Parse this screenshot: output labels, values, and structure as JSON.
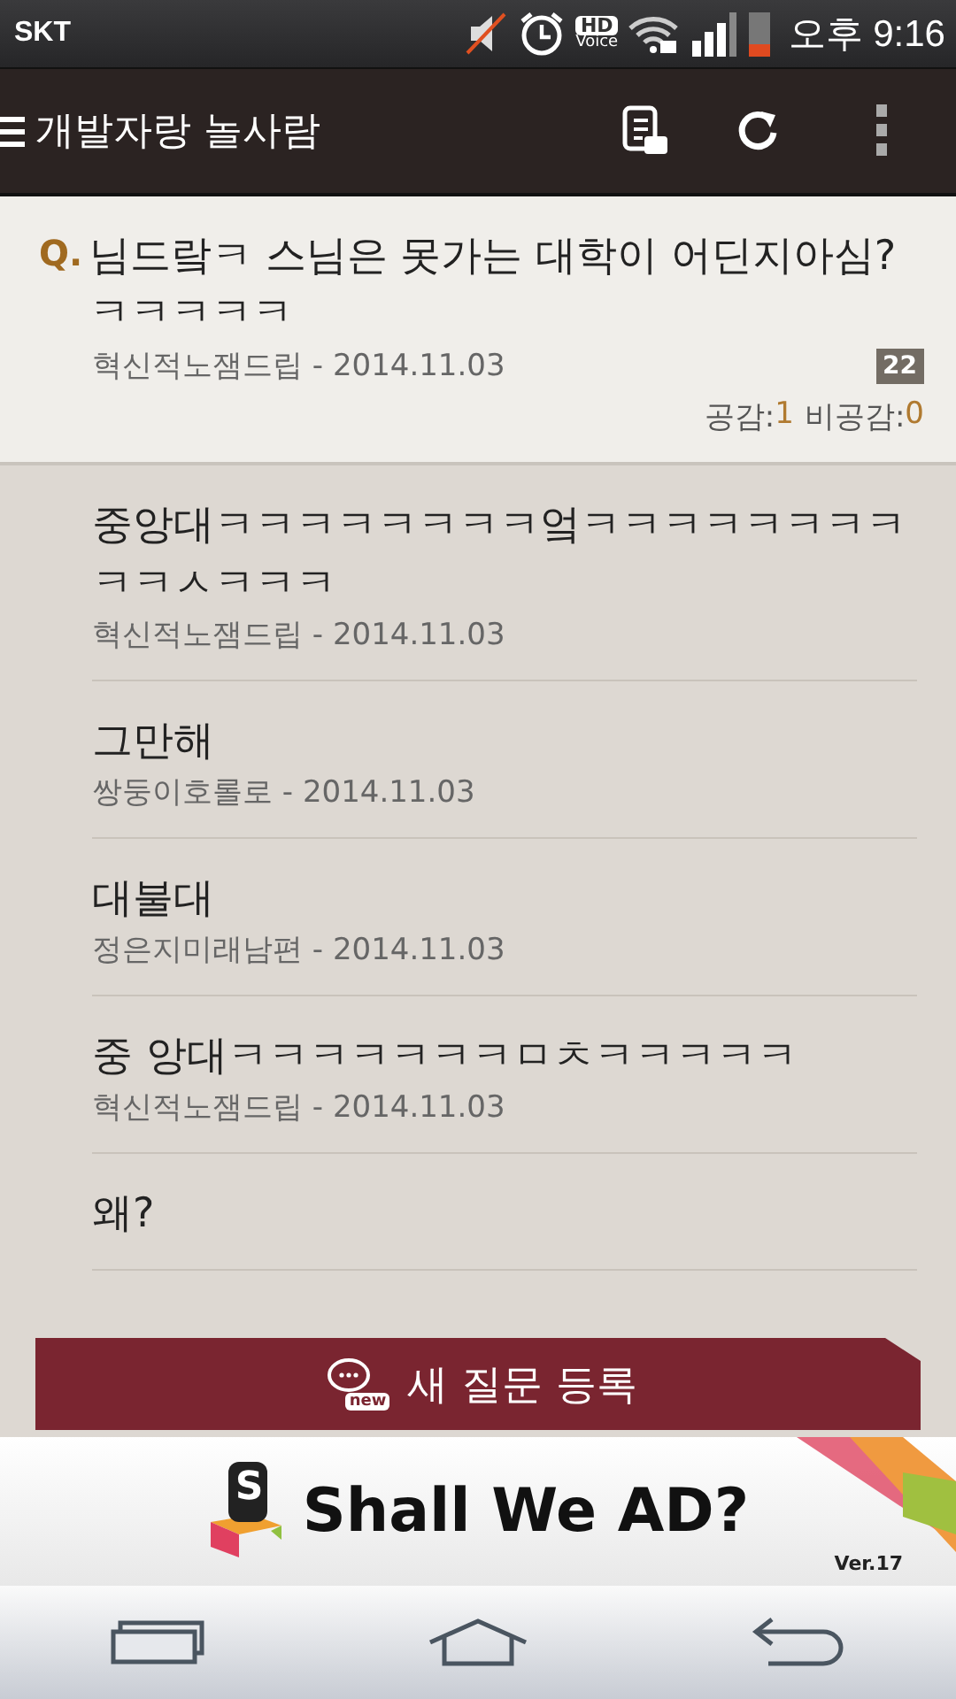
{
  "status_bar": {
    "carrier": "SKT",
    "hd_label": "HD",
    "hd_sublabel": "Voice",
    "time": "오후 9:16"
  },
  "toolbar": {
    "title": "개발자랑 놀사람"
  },
  "question": {
    "marker": "Q.",
    "title": "님드랔ㅋ 스님은 못가는 대학이 어딘지아심?ㅋㅋㅋㅋㅋ",
    "meta": "혁신적노잼드립 - 2014.11.03",
    "answer_count": "22",
    "likes_label": "공감:",
    "likes": "1",
    "dislikes_label": "비공감:",
    "dislikes": "0"
  },
  "answers": [
    {
      "text": "중앙대ㅋㅋㅋㅋㅋㅋㅋㅋ엌ㅋㅋㅋㅋㅋㅋㅋㅋㅋㅋㅅㅋㅋㅋ",
      "meta": "혁신적노잼드립 - 2014.11.03"
    },
    {
      "text": "그만해",
      "meta": "쌍둥이호롤로 - 2014.11.03"
    },
    {
      "text": "대불대",
      "meta": "정은지미래남편 - 2014.11.03"
    },
    {
      "text": "중 앙대ㅋㅋㅋㅋㅋㅋㅋㅁㅊㅋㅋㅋㅋㅋ",
      "meta": "혁신적노잼드립 - 2014.11.03"
    },
    {
      "text": "왜?"
    }
  ],
  "new_question_button": {
    "icon_label": "new",
    "label": "새 질문 등록"
  },
  "ad": {
    "logo_letter": "S",
    "text": "Shall We AD?",
    "version": "Ver.17"
  }
}
